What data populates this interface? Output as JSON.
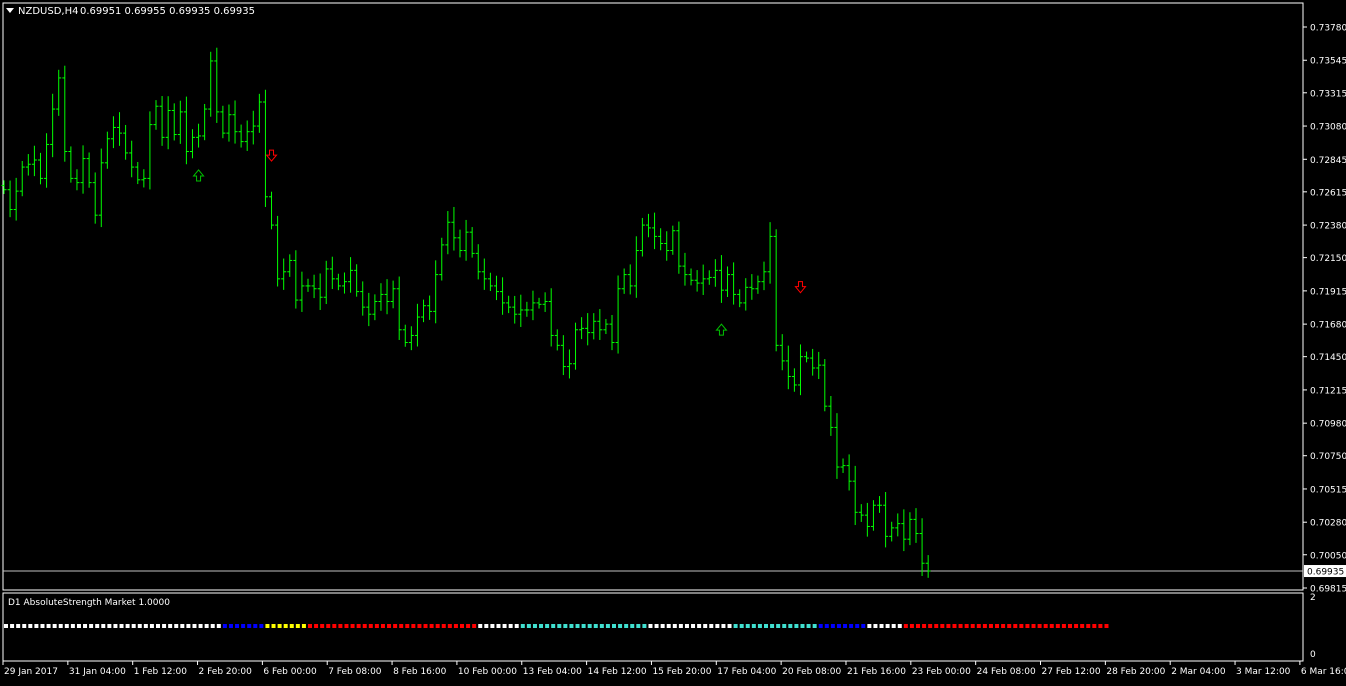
{
  "header": {
    "symbol": "NZDUSD,H4",
    "ohlc": "0.69951 0.69955 0.69935 0.69935",
    "dropdown_icon": "triangle-down-icon"
  },
  "colors": {
    "background": "#000000",
    "candle": "#00ff00",
    "axis": "#ffffff",
    "price_line": "#c0c0c0",
    "arrow_up": "#00c000",
    "arrow_down": "#ff0000"
  },
  "indicator": {
    "label": "D1  AbsoluteStrength Market 1.0000",
    "y_ticks": [
      "2",
      "0"
    ],
    "segments": [
      {
        "color": "#ffffff",
        "count": 36
      },
      {
        "color": "#0000ff",
        "count": 7
      },
      {
        "color": "#ffff00",
        "count": 7
      },
      {
        "color": "#ff0000",
        "count": 28
      },
      {
        "color": "#ffffff",
        "count": 7
      },
      {
        "color": "#40e0d0",
        "count": 21
      },
      {
        "color": "#ffffff",
        "count": 14
      },
      {
        "color": "#40e0d0",
        "count": 14
      },
      {
        "color": "#0000ff",
        "count": 8
      },
      {
        "color": "#ffffff",
        "count": 6
      },
      {
        "color": "#ff0000",
        "count": 34
      }
    ]
  },
  "chart_data": {
    "type": "ohlc",
    "title": "NZDUSD,H4",
    "ylim": [
      0.69815,
      0.7394
    ],
    "y_ticks": [
      "0.73780",
      "0.73545",
      "0.73315",
      "0.73080",
      "0.72845",
      "0.72615",
      "0.72380",
      "0.72150",
      "0.71915",
      "0.71680",
      "0.71450",
      "0.71215",
      "0.70980",
      "0.70750",
      "0.70515",
      "0.70280",
      "0.70050",
      "0.69815"
    ],
    "current_price": "0.69935",
    "x_labels": [
      "29 Jan 2017",
      "31 Jan 04:00",
      "1 Feb 12:00",
      "2 Feb 20:00",
      "6 Feb 00:00",
      "7 Feb 08:00",
      "8 Feb 16:00",
      "10 Feb 00:00",
      "13 Feb 04:00",
      "14 Feb 12:00",
      "15 Feb 20:00",
      "17 Feb 04:00",
      "20 Feb 08:00",
      "21 Feb 16:00",
      "23 Feb 00:00",
      "24 Feb 08:00",
      "27 Feb 12:00",
      "28 Feb 20:00",
      "2 Mar 04:00",
      "3 Mar 12:00",
      "6 Mar 16:00"
    ],
    "closes": [
      0.7263,
      0.7249,
      0.7262,
      0.7279,
      0.7281,
      0.7284,
      0.7271,
      0.7295,
      0.732,
      0.7342,
      0.729,
      0.7271,
      0.7268,
      0.7285,
      0.7268,
      0.7245,
      0.7282,
      0.7299,
      0.7307,
      0.7303,
      0.7289,
      0.7279,
      0.727,
      0.7271,
      0.7309,
      0.7322,
      0.73,
      0.7319,
      0.7302,
      0.7318,
      0.729,
      0.73,
      0.7301,
      0.732,
      0.7354,
      0.7318,
      0.7303,
      0.7316,
      0.7304,
      0.7297,
      0.7304,
      0.7308,
      0.7325,
      0.7258,
      0.7238,
      0.72,
      0.7205,
      0.7213,
      0.7185,
      0.7195,
      0.7195,
      0.7193,
      0.7187,
      0.7207,
      0.72,
      0.7195,
      0.7198,
      0.7206,
      0.7191,
      0.718,
      0.7175,
      0.7184,
      0.7189,
      0.7184,
      0.7193,
      0.7164,
      0.7155,
      0.716,
      0.7173,
      0.7181,
      0.7177,
      0.7203,
      0.7224,
      0.724,
      0.7229,
      0.722,
      0.7233,
      0.7218,
      0.7205,
      0.72,
      0.7195,
      0.7191,
      0.7183,
      0.718,
      0.7175,
      0.7178,
      0.7178,
      0.7183,
      0.7182,
      0.7184,
      0.716,
      0.7153,
      0.7138,
      0.714,
      0.7164,
      0.7165,
      0.7162,
      0.717,
      0.7164,
      0.7168,
      0.7155,
      0.7193,
      0.7203,
      0.7195,
      0.722,
      0.7238,
      0.7236,
      0.723,
      0.7225,
      0.722,
      0.7234,
      0.7209,
      0.7203,
      0.7199,
      0.7197,
      0.72,
      0.7201,
      0.7206,
      0.7192,
      0.7203,
      0.7189,
      0.7183,
      0.7194,
      0.7193,
      0.7198,
      0.7205,
      0.723,
      0.7153,
      0.7142,
      0.7131,
      0.7125,
      0.7145,
      0.7144,
      0.7137,
      0.7139,
      0.711,
      0.7095,
      0.7067,
      0.7068,
      0.7057,
      0.7035,
      0.7033,
      0.7025,
      0.704,
      0.704,
      0.7018,
      0.7024,
      0.7027,
      0.7016,
      0.703,
      0.702,
      0.6999,
      0.69935
    ],
    "arrows": [
      {
        "direction": "up",
        "bar": 32
      },
      {
        "direction": "down",
        "bar": 44
      },
      {
        "direction": "up",
        "bar": 118
      },
      {
        "direction": "down",
        "bar": 131
      }
    ]
  }
}
